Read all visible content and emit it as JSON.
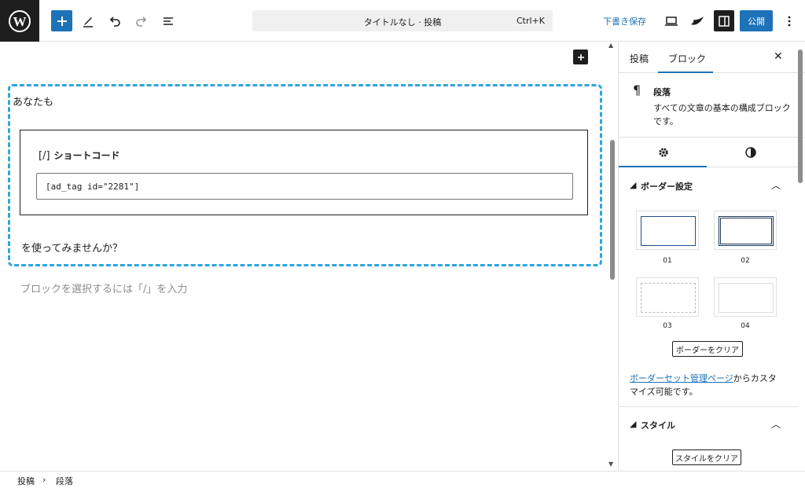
{
  "toolbar": {
    "doc_title": "タイトルなし · 投稿",
    "shortcut": "Ctrl+K",
    "save_draft": "下書き保存",
    "publish": "公開"
  },
  "editor": {
    "para_top": "あなたも",
    "shortcode_label": "ショートコード",
    "shortcode_bracket": "[/]",
    "shortcode_value": "[ad_tag id=\"2281\"]",
    "para_bottom": "を使ってみませんか？",
    "placeholder": "ブロックを選択するには「/」を入力"
  },
  "sidebar": {
    "tabs": [
      "投稿",
      "ブロック"
    ],
    "active_tab": "ブロック",
    "block_name": "段落",
    "block_desc": "すべての文章の基本の構成ブロックです。",
    "border_panel_title": "ボーダー設定",
    "presets": [
      "01",
      "02",
      "03",
      "04"
    ],
    "clear_border": "ボーダーをクリア",
    "note_link": "ボーダーセット管理ページ",
    "note_rest": "からカスタマイズ可能です。",
    "style_panel_title": "スタイル",
    "clear_style": "スタイルをクリア"
  },
  "footer": {
    "crumbs": [
      "投稿",
      "段落"
    ]
  },
  "colors": {
    "accent": "#1e72b8",
    "selection": "#2fa6dc",
    "dark": "#1e1e1e"
  }
}
